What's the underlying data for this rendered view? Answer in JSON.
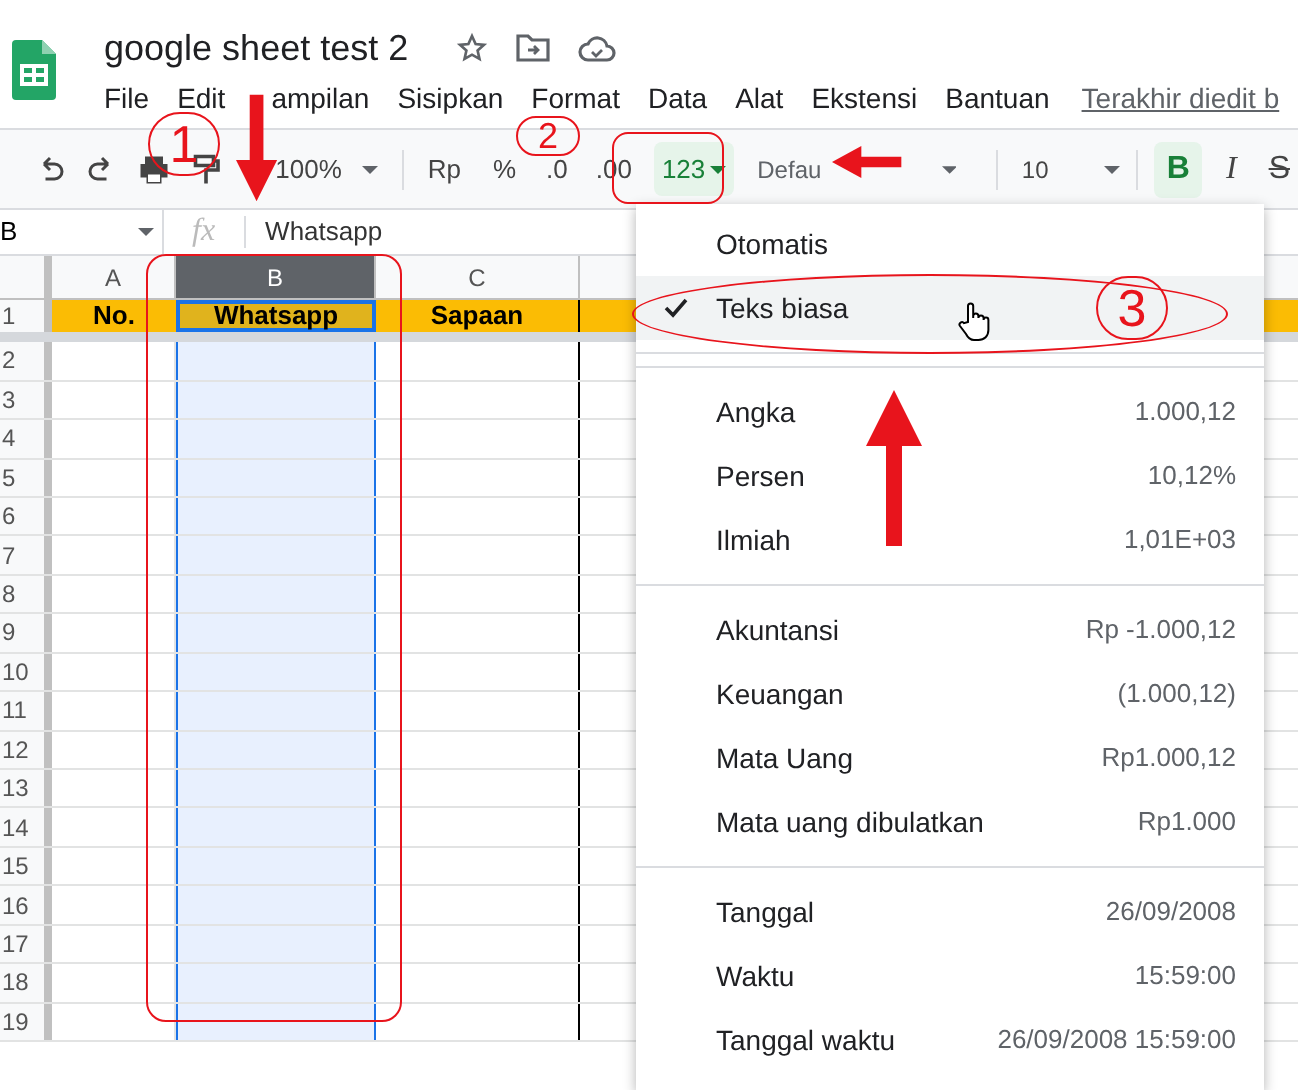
{
  "doc_title": "google sheet test 2",
  "menu": [
    "File",
    "Edit",
    "ampilan",
    "Sisipkan",
    "Format",
    "Data",
    "Alat",
    "Ekstensi",
    "Bantuan"
  ],
  "last_edit": "Terakhir diedit b",
  "toolbar": {
    "zoom": "100%",
    "currency": "Rp",
    "percent": "%",
    "decrease_decimal": ".0",
    "increase_decimal": ".00",
    "number_format": "123",
    "font": "Defau",
    "font_size": "10",
    "bold": {
      "label": "B",
      "selected": true
    },
    "italic": "I",
    "strikethrough": "S"
  },
  "name_box": "B",
  "fx": "fx",
  "formula": "Whatsapp",
  "columns": [
    {
      "label": "A",
      "selected": false
    },
    {
      "label": "B",
      "selected": true
    },
    {
      "label": "C",
      "selected": false
    }
  ],
  "header_row": [
    "No.",
    "Whatsapp",
    "Sapaan"
  ],
  "row_numbers": [
    "1",
    "2",
    "3",
    "4",
    "5",
    "6",
    "7",
    "8",
    "9",
    "10",
    "11",
    "12",
    "13",
    "14",
    "15",
    "16",
    "17",
    "18",
    "19"
  ],
  "format_menu": [
    [
      {
        "label": "Otomatis",
        "checked": false
      }
    ],
    [
      {
        "label": "Teks biasa",
        "checked": true
      }
    ],
    [
      {
        "label": "Angka",
        "example": "1.000,12",
        "checked": false
      },
      {
        "label": "Persen",
        "example": "10,12%",
        "checked": false
      },
      {
        "label": "Ilmiah",
        "example": "1,01E+03",
        "checked": false
      }
    ],
    [
      {
        "label": "Akuntansi",
        "example": "Rp -1.000,12",
        "checked": false
      },
      {
        "label": "Keuangan",
        "example": "(1.000,12)",
        "checked": false
      },
      {
        "label": "Mata Uang",
        "example": "Rp1.000,12",
        "checked": false
      },
      {
        "label": "Mata uang dibulatkan",
        "example": "Rp1.000",
        "checked": false
      }
    ],
    [
      {
        "label": "Tanggal",
        "example": "26/09/2008",
        "checked": false
      },
      {
        "label": "Waktu",
        "example": "15:59:00",
        "checked": false
      },
      {
        "label": "Tanggal waktu",
        "example": "26/09/2008 15:59:00",
        "checked": false
      }
    ]
  ],
  "annotations": [
    "1",
    "2",
    "3"
  ]
}
